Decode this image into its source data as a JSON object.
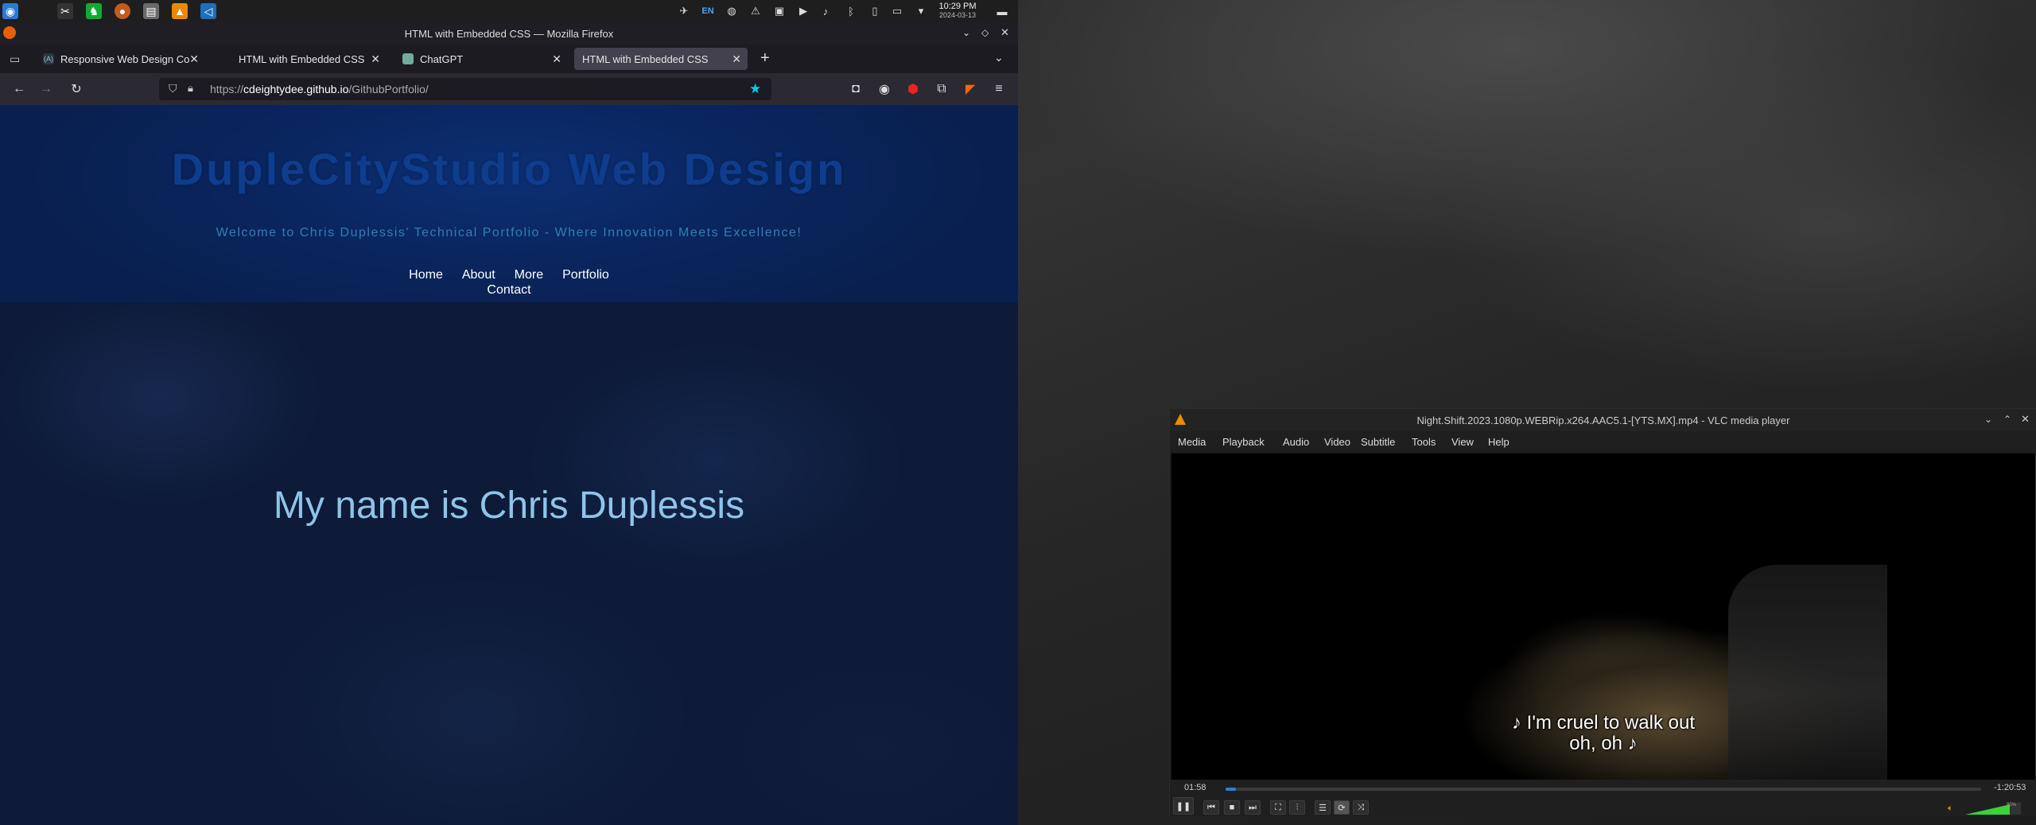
{
  "panel": {
    "clock_time": "10:29 PM",
    "clock_date": "2024-03-13",
    "lang": "EN"
  },
  "firefox": {
    "window_title": "HTML with Embedded CSS — Mozilla Firefox",
    "tabs": [
      {
        "label": "Responsive Web Design Co"
      },
      {
        "label": "HTML with Embedded CSS"
      },
      {
        "label": "ChatGPT"
      },
      {
        "label": "HTML with Embedded CSS"
      }
    ],
    "url_prefix": "https://",
    "url_host": "cdeightydee.github.io",
    "url_path": "/GithubPortfolio/"
  },
  "site": {
    "title": "DupleCityStudio Web Design",
    "tagline": "Welcome to Chris Duplessis' Technical Portfolio - Where Innovation Meets Excellence!",
    "nav": [
      "Home",
      "About",
      "More",
      "Portfolio",
      "Contact"
    ],
    "heading": "My name is Chris Duplessis"
  },
  "vlc": {
    "window_title": "Night.Shift.2023.1080p.WEBRip.x264.AAC5.1-[YTS.MX].mp4 - VLC media player",
    "menu": [
      "Media",
      "Playback",
      "Audio",
      "Video",
      "Subtitle",
      "Tools",
      "View",
      "Help"
    ],
    "subtitle_line1": "♪ I'm cruel to walk out",
    "subtitle_line2": "oh, oh ♪",
    "elapsed": "01:58",
    "remaining": "-1:20:53",
    "progress": 0.014,
    "volume_label": "80%",
    "volume": 0.8
  }
}
